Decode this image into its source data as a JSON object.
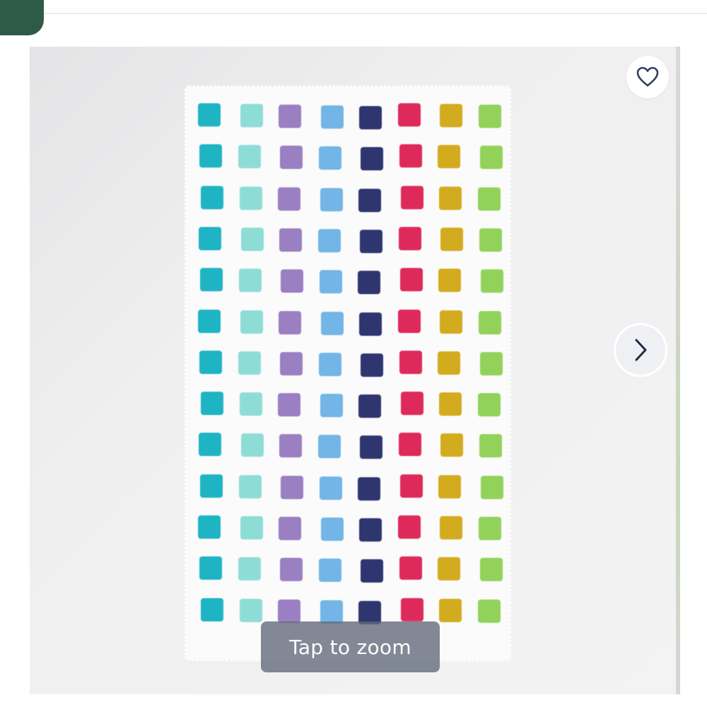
{
  "product_gallery": {
    "zoom_hint": "Tap to zoom",
    "icons": {
      "favorite": "heart-icon",
      "next": "chevron-right-icon"
    },
    "colors": {
      "brand_tab": "#2e5b47",
      "rug_base": "#fbfbfb",
      "zoom_hint_bg": "#606878"
    },
    "rug_pattern": {
      "columns": [
        "turquoise",
        "aqua",
        "lavender",
        "sky-blue",
        "navy",
        "magenta",
        "mustard",
        "lime"
      ],
      "column_colors": [
        "#1fb4c4",
        "#8edcd6",
        "#9a7fc2",
        "#72b5e6",
        "#2f356f",
        "#de2a5a",
        "#d3ab1e",
        "#92d25a"
      ],
      "rows": 13
    }
  }
}
